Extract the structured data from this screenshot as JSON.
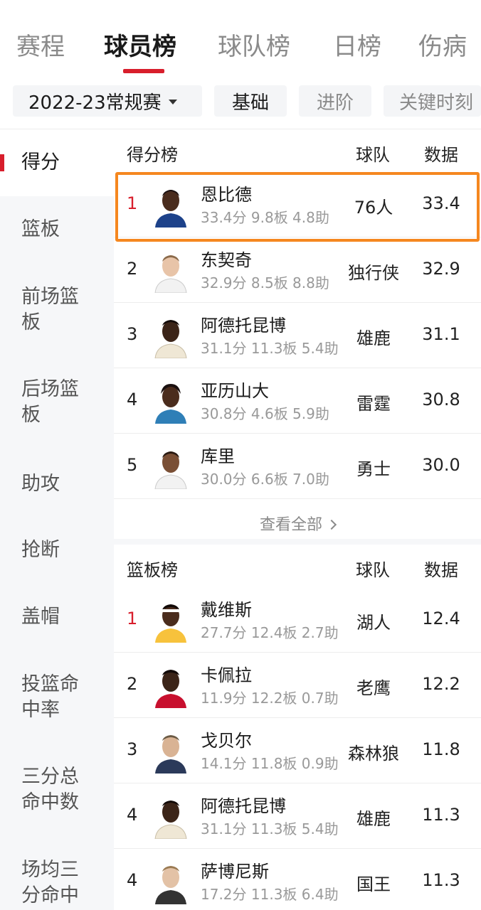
{
  "nav": {
    "tabs": [
      {
        "label": "赛程"
      },
      {
        "label": "球员榜"
      },
      {
        "label": "球队榜"
      },
      {
        "label": "日榜"
      },
      {
        "label": "伤病"
      }
    ],
    "active_index": 1
  },
  "filters": {
    "season": "2022-23常规赛",
    "chips": [
      {
        "label": "基础"
      },
      {
        "label": "进阶"
      },
      {
        "label": "关键时刻"
      }
    ]
  },
  "sidebar": {
    "items": [
      {
        "label": "得分"
      },
      {
        "label": "篮板"
      },
      {
        "label": "前场篮板"
      },
      {
        "label": "后场篮板"
      },
      {
        "label": "助攻"
      },
      {
        "label": "抢断"
      },
      {
        "label": "盖帽"
      },
      {
        "label": "投篮命中率"
      },
      {
        "label": "三分总命中数"
      },
      {
        "label": "场均三分命中"
      }
    ]
  },
  "sections": [
    {
      "title": "得分榜",
      "col_team": "球队",
      "col_value": "数据",
      "rows": [
        {
          "rank": "1",
          "name": "恩比德",
          "stats": "33.4分 9.8板 4.8助",
          "team": "76人",
          "value": "33.4"
        },
        {
          "rank": "2",
          "name": "东契奇",
          "stats": "32.9分 8.5板 8.8助",
          "team": "独行侠",
          "value": "32.9"
        },
        {
          "rank": "3",
          "name": "阿德托昆博",
          "stats": "31.1分 11.3板 5.4助",
          "team": "雄鹿",
          "value": "31.1"
        },
        {
          "rank": "4",
          "name": "亚历山大",
          "stats": "30.8分 4.6板 5.9助",
          "team": "雷霆",
          "value": "30.8"
        },
        {
          "rank": "5",
          "name": "库里",
          "stats": "30.0分 6.6板 7.0助",
          "team": "勇士",
          "value": "30.0"
        }
      ],
      "view_all": "查看全部"
    },
    {
      "title": "篮板榜",
      "col_team": "球队",
      "col_value": "数据",
      "rows": [
        {
          "rank": "1",
          "name": "戴维斯",
          "stats": "27.7分 12.4板 2.7助",
          "team": "湖人",
          "value": "12.4"
        },
        {
          "rank": "2",
          "name": "卡佩拉",
          "stats": "11.9分 12.2板 0.7助",
          "team": "老鹰",
          "value": "12.2"
        },
        {
          "rank": "3",
          "name": "戈贝尔",
          "stats": "14.1分 11.8板 0.9助",
          "team": "森林狼",
          "value": "11.8"
        },
        {
          "rank": "4",
          "name": "阿德托昆博",
          "stats": "31.1分 11.3板 5.4助",
          "team": "雄鹿",
          "value": "11.3"
        },
        {
          "rank": "4",
          "name": "萨博尼斯",
          "stats": "17.2分 11.3板 6.4助",
          "team": "国王",
          "value": "11.3"
        }
      ]
    }
  ],
  "colors": {
    "accent": "#d81e2c",
    "highlight": "#f5871f",
    "sidebar_bg": "#f6f7f9"
  }
}
